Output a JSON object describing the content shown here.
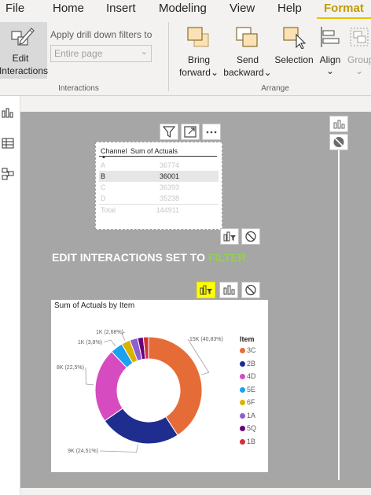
{
  "menu": [
    "File",
    "Home",
    "Insert",
    "Modeling",
    "View",
    "Help",
    "Format"
  ],
  "ribbon": {
    "edit_interactions": [
      "Edit",
      "Interactions"
    ],
    "drill_filter_label": "Apply drill down filters to",
    "drill_filter_value": "Entire page",
    "interactions_group": "Interactions",
    "bring_forward": [
      "Bring",
      "forward"
    ],
    "send_backward": [
      "Send",
      "backward"
    ],
    "selection": "Selection",
    "align": "Align",
    "group": "Group",
    "arrange_group": "Arrange"
  },
  "table": {
    "headers": [
      "Channel",
      "Sum of Actuals"
    ],
    "rows": [
      {
        "channel": "A",
        "value": "36774"
      },
      {
        "channel": "B",
        "value": "36001"
      },
      {
        "channel": "C",
        "value": "36393"
      },
      {
        "channel": "D",
        "value": "35238"
      }
    ],
    "total_label": "Total",
    "total_value": "144911"
  },
  "banner": {
    "prefix": "EDIT INTERACTIONS SET TO ",
    "highlight": "FILTER"
  },
  "chart_data": {
    "type": "pie",
    "title": "Sum of Actuals by Item",
    "legend_title": "Item",
    "legend_position": "right",
    "slices": [
      {
        "label": "3C",
        "value": 40.83,
        "display": "15K (40,83%)",
        "color": "#e66c37"
      },
      {
        "label": "2B",
        "value": 24.51,
        "display": "9K (24,51%)",
        "color": "#1f2d8f"
      },
      {
        "label": "4D",
        "value": 22.5,
        "display": "8K (22,5%)",
        "color": "#d64bc0"
      },
      {
        "label": "5E",
        "value": 3.8,
        "display": "1K (3,8%)",
        "color": "#1aa1f0"
      },
      {
        "label": "6F",
        "value": 2.68,
        "display": "1K (2,68%)",
        "color": "#d9b300"
      },
      {
        "label": "1A",
        "value": 2.4,
        "display": "",
        "color": "#8e5fd0"
      },
      {
        "label": "5Q",
        "value": 1.7,
        "display": "",
        "color": "#6b007b"
      },
      {
        "label": "1B",
        "value": 1.58,
        "display": "",
        "color": "#d13438"
      }
    ]
  }
}
